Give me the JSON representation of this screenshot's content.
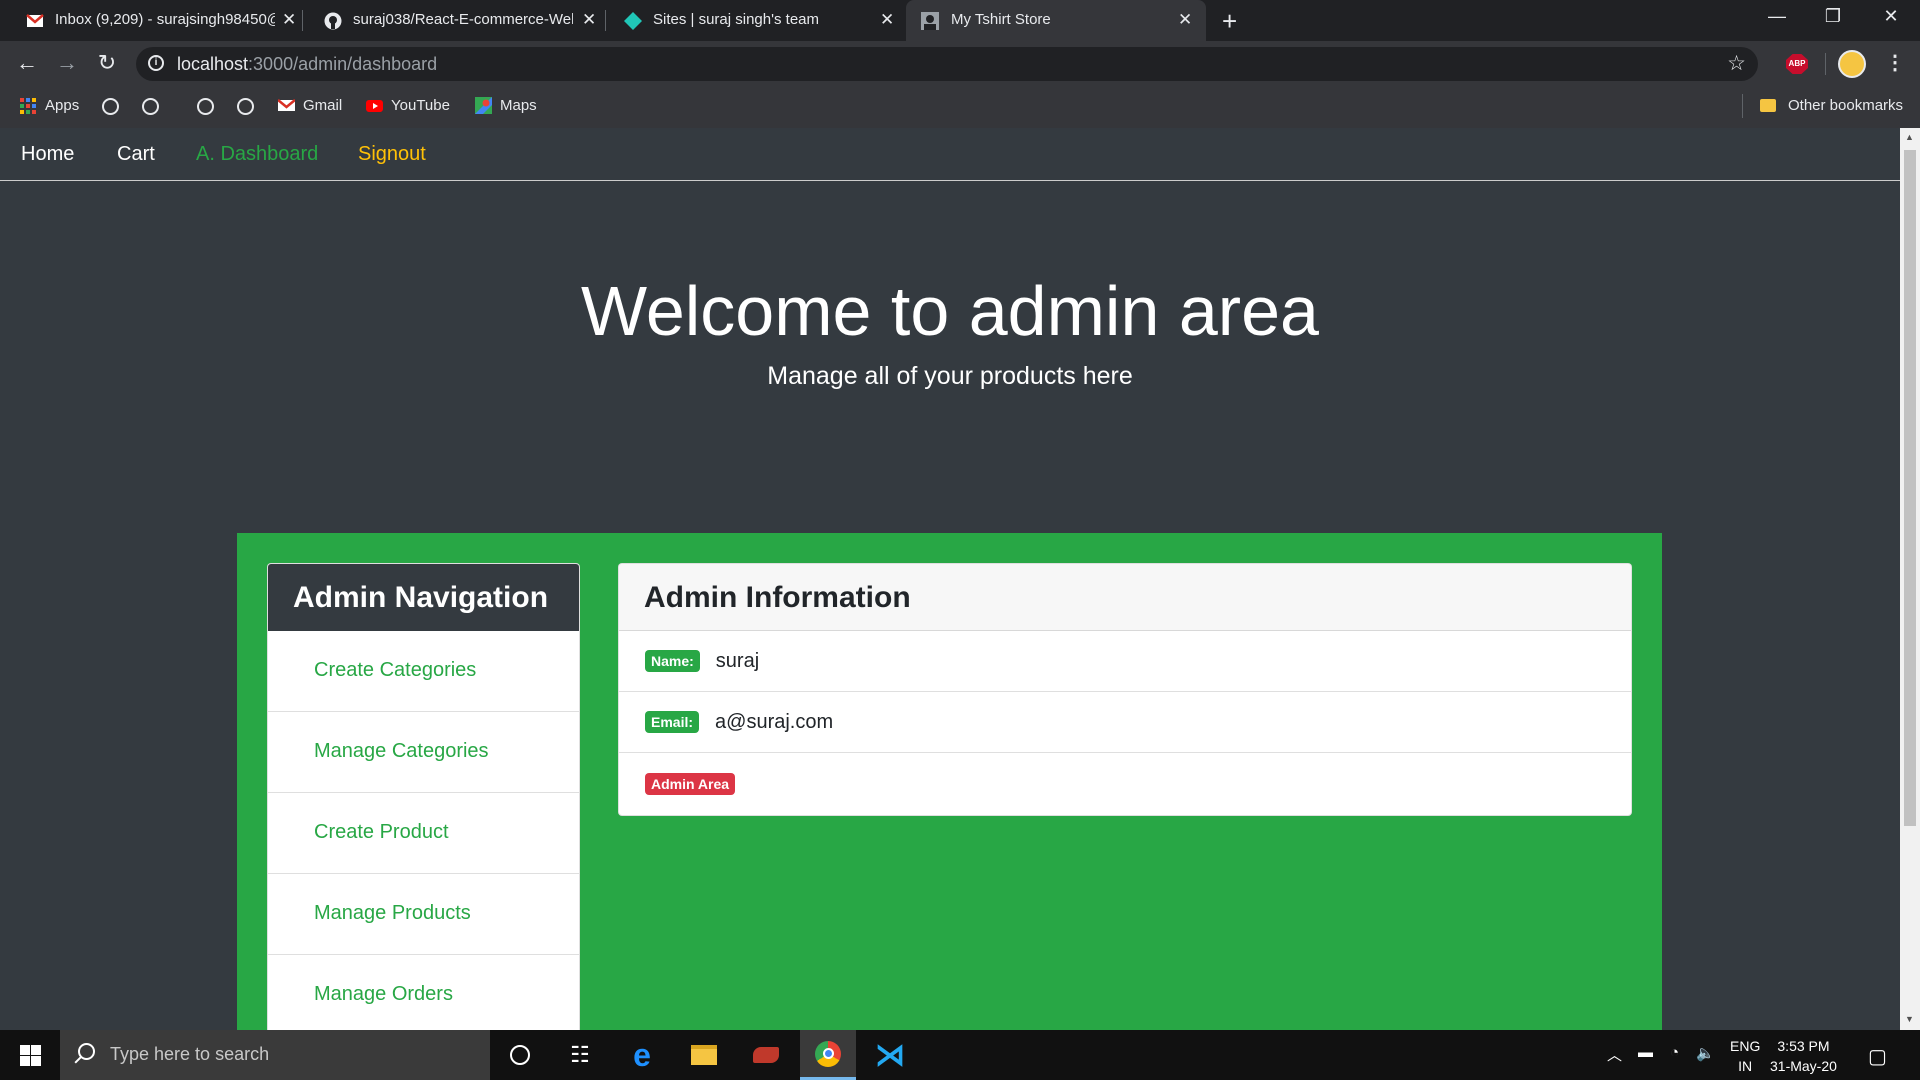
{
  "browser": {
    "tabs": [
      {
        "title": "Inbox (9,209) - surajsingh98450@",
        "favicon": "gmail-icon",
        "active": false
      },
      {
        "title": "suraj038/React-E-commerce-Wel",
        "favicon": "github-icon",
        "active": false
      },
      {
        "title": "Sites | suraj singh's team",
        "favicon": "netlify-icon",
        "active": false
      },
      {
        "title": "My Tshirt Store",
        "favicon": "site-icon",
        "active": true
      }
    ],
    "new_tab": "+",
    "url_host": "localhost",
    "url_path": ":3000/admin/dashboard",
    "abp_label": "ABP",
    "bookmarks": {
      "apps": "Apps",
      "gmail": "Gmail",
      "youtube": "YouTube",
      "maps": "Maps",
      "other": "Other bookmarks"
    }
  },
  "site_nav": {
    "home": "Home",
    "cart": "Cart",
    "dashboard": "A. Dashboard",
    "signout": "Signout",
    "colors": {
      "default": "#ffffff",
      "active": "#28a745",
      "signout": "#ffc107"
    }
  },
  "hero": {
    "title": "Welcome to admin area",
    "subtitle": "Manage all of your products here"
  },
  "admin_nav": {
    "header": "Admin Navigation",
    "items": [
      "Create Categories",
      "Manage Categories",
      "Create Product",
      "Manage Products",
      "Manage Orders"
    ]
  },
  "admin_info": {
    "header": "Admin Information",
    "name_label": "Name:",
    "name_value": "suraj",
    "email_label": "Email:",
    "email_value": "a@suraj.com",
    "area_badge": "Admin Area"
  },
  "taskbar": {
    "search_placeholder": "Type here to search",
    "lang_top": "ENG",
    "lang_bottom": "IN",
    "time": "3:53 PM",
    "date": "31-May-20"
  }
}
